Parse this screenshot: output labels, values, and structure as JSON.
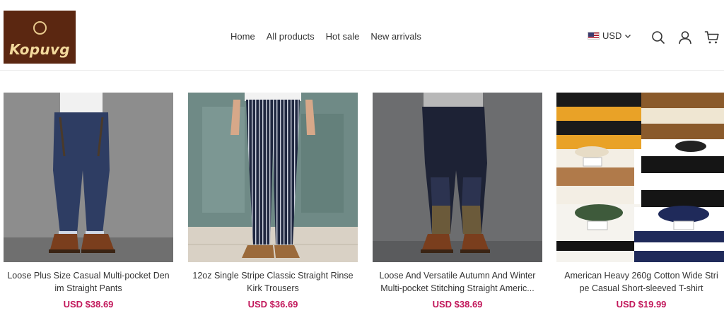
{
  "brand": {
    "name": "Kopuvg"
  },
  "nav": [
    {
      "label": "Home"
    },
    {
      "label": "All products"
    },
    {
      "label": "Hot sale"
    },
    {
      "label": "New arrivals"
    }
  ],
  "header": {
    "currency": "USD",
    "icons": [
      "search-icon",
      "account-icon",
      "cart-icon"
    ]
  },
  "products": [
    {
      "title": "Loose Plus Size Casual Multi-pocket Den im Straight Pants",
      "price": "USD $38.69"
    },
    {
      "title": "12oz Single Stripe Classic Straight Rinse Kirk Trousers",
      "price": "USD $36.69"
    },
    {
      "title": "Loose And Versatile Autumn And Winter Multi-pocket Stitching Straight Americ...",
      "price": "USD $38.69"
    },
    {
      "title": "American Heavy 260g Cotton Wide Stri pe Casual Short-sleeved T-shirt",
      "price": "USD $19.99"
    }
  ],
  "colors": {
    "price": "#c2185b",
    "logo_bg": "#5b2711",
    "logo_text": "#f3d99c"
  }
}
